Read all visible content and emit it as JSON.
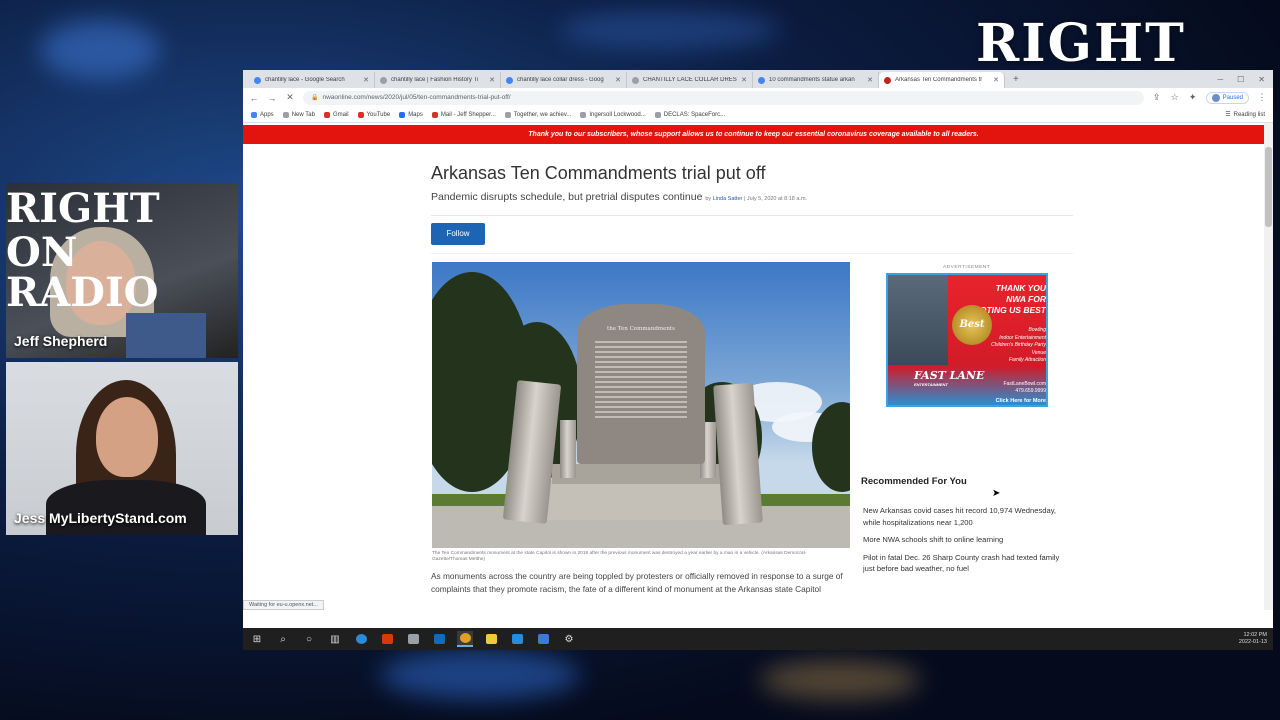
{
  "stream": {
    "brand_logo": "RIGHT ON RADIO",
    "brand_logo_word": "RIGHT",
    "brand_logo_mic": "🎙",
    "cam_logo_line1": "RIGHT",
    "cam_logo_line2": "ON RADIO",
    "host_name": "Jeff Shepherd",
    "guest_name": "Jess MyLibertyStand.com"
  },
  "browser": {
    "tabs": [
      {
        "label": "chantilly lace - Google Search",
        "icon": "google-icon"
      },
      {
        "label": "chantilly lace | Fashion History Ti",
        "icon": "site-icon"
      },
      {
        "label": "chantilly lace collar dress - Goog",
        "icon": "google-icon"
      },
      {
        "label": "CHANTILLY LACE COLLAR DRES",
        "icon": "site-icon"
      },
      {
        "label": "10 commandments statue arkan",
        "icon": "google-icon"
      },
      {
        "label": "Arkansas Ten Commandments tr",
        "icon": "loading-icon"
      }
    ],
    "active_tab_index": 5,
    "new_tab_symbol": "+",
    "url": "nwaonline.com/news/2020/jul/05/ten-commandments-trial-put-off/",
    "profile_label": "Paused",
    "bookmarks": [
      {
        "label": "Apps",
        "icon": "apps-grid-icon"
      },
      {
        "label": "New Tab",
        "icon": "globe-icon"
      },
      {
        "label": "Gmail",
        "icon": "gmail-icon"
      },
      {
        "label": "YouTube",
        "icon": "youtube-icon"
      },
      {
        "label": "Maps",
        "icon": "maps-icon"
      },
      {
        "label": "Mail - Jeff Shepper...",
        "icon": "mail-icon"
      },
      {
        "label": "Together, we achiev...",
        "icon": "link-icon"
      },
      {
        "label": "Ingersoll Lockwood...",
        "icon": "link-icon"
      },
      {
        "label": "DECLAS: SpaceForc...",
        "icon": "link-icon"
      }
    ],
    "reading_list": "Reading list",
    "status_text": "Waiting for eu-u.openx.net..."
  },
  "article": {
    "banner": "Thank you to our subscribers, whose support allows us to continue to keep our essential coronavirus coverage available to all readers.",
    "headline": "Arkansas Ten Commandments trial put off",
    "subhead": "Pandemic disrupts schedule, but pretrial disputes continue",
    "byline_prefix": "by",
    "author": "Linda Satter",
    "date": "| July 5, 2020 at 8:18 a.m.",
    "follow_label": "Follow",
    "tablet_title": "the Ten Commandments",
    "image_caption": "The Ten Commandments monument at the state Capitol is shown in 2018 after the previous monument was destroyed a year earlier by a man in a vehicle. (Arkansas Democrat-Gazette/Thomas Metthe)",
    "body_text": "As monuments across the country are being toppled by protesters or officially removed in response to a surge of complaints that they promote racism, the fate of a different kind of monument at the Arkansas state Capitol"
  },
  "sidebar": {
    "ad_label": "ADVERTISEMENT",
    "ad": {
      "headline": "THANK YOU NWA FOR VOTING US BEST",
      "badge": "Best",
      "services": [
        "Bowling",
        "Indoor Entertainment",
        "Children's Birthday Party Venue",
        "Family Attraction"
      ],
      "brand": "FAST LANE",
      "brand_sub": "ENTERTAINMENT",
      "website": "FastLaneBowl.com",
      "phone": "479.659.9999",
      "cta": "Click Here for More"
    },
    "recommended_title": "Recommended For You",
    "recommended": [
      "New Arkansas covid cases hit record 10,974 Wednesday, while hospitalizations near 1,200",
      "More NWA schools shift to online learning",
      "Pilot in fatal Dec. 26 Sharp County crash had texted family just before bad weather, no fuel"
    ]
  },
  "taskbar": {
    "time": "12:02 PM",
    "date": "2022-01-13"
  }
}
